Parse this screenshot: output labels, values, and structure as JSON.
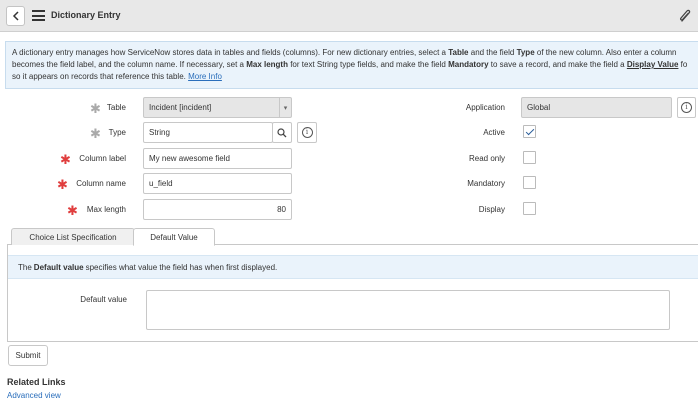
{
  "header": {
    "title": "Dictionary Entry",
    "icons": {
      "back": "chevron-left-icon",
      "menu": "hamburger-icon",
      "attach": "paperclip-icon"
    }
  },
  "banner": {
    "line1_a": "A dictionary entry manages how ServiceNow stores data in tables and fields (columns). For new dictionary entries, select a ",
    "b_table": "Table",
    "line1_b": " and the field ",
    "b_type": "Type",
    "line1_c": " of the new column. Also enter a column",
    "line2_a": "becomes the field label, and the column name. If necessary, set a ",
    "b_maxlen": "Max length",
    "line2_b": " for text String type fields, and make the field ",
    "b_mandatory": "Mandatory",
    "line2_c": " to save a record, and make the field a ",
    "b_display": "Display Value",
    "line2_d": " fo",
    "line3": "so it appears on records that reference this table. ",
    "more_info": "More Info"
  },
  "form": {
    "table": {
      "label": "Table",
      "value": "Incident [incident]"
    },
    "type": {
      "label": "Type",
      "value": "String"
    },
    "column_label": {
      "label": "Column label",
      "value": "My new awesome field"
    },
    "column_name": {
      "label": "Column name",
      "value": "u_field"
    },
    "max_length": {
      "label": "Max length",
      "value": "80"
    },
    "application": {
      "label": "Application",
      "value": "Global"
    },
    "active": {
      "label": "Active",
      "checked": true
    },
    "read_only": {
      "label": "Read only",
      "checked": false
    },
    "mandatory": {
      "label": "Mandatory",
      "checked": false
    },
    "display": {
      "label": "Display",
      "checked": false
    }
  },
  "tabs": [
    {
      "label": "Choice List Specification",
      "active": false
    },
    {
      "label": "Default Value",
      "active": true
    }
  ],
  "tab_panel": {
    "info_pre": "The ",
    "info_bold": "Default value",
    "info_post": " specifies what value the field has when first displayed.",
    "default_value_label": "Default value",
    "default_value": ""
  },
  "submit_label": "Submit",
  "related": {
    "title": "Related Links",
    "links": [
      "Advanced view"
    ]
  },
  "colors": {
    "required": "#e03e3e",
    "link": "#2a6ebb",
    "banner_bg": "#eaf3fb",
    "header_bg": "#e8e8e8"
  }
}
